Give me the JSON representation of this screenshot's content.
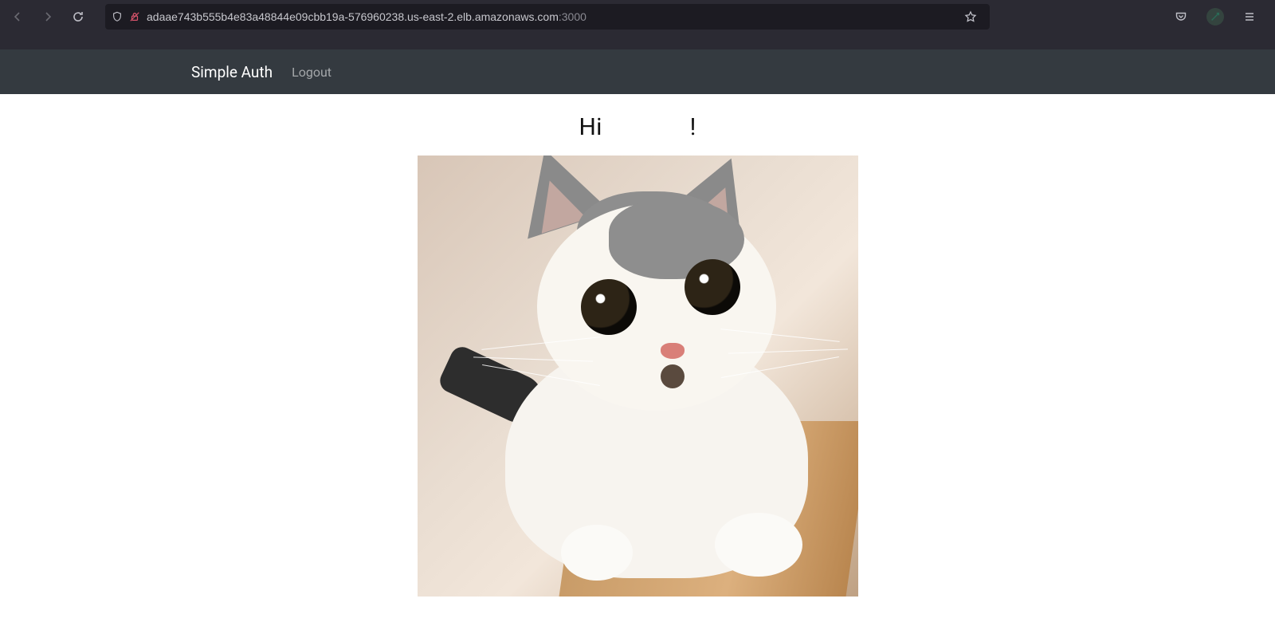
{
  "browser": {
    "url_host": "adaae743b555b4e83a48844e09cbb19a-576960238.us-east-2.elb.amazonaws.com",
    "url_port": ":3000"
  },
  "navbar": {
    "brand": "Simple Auth",
    "logout": "Logout"
  },
  "page": {
    "greeting_prefix": "Hi",
    "greeting_suffix": "!",
    "image_alt": "cute kitten"
  }
}
